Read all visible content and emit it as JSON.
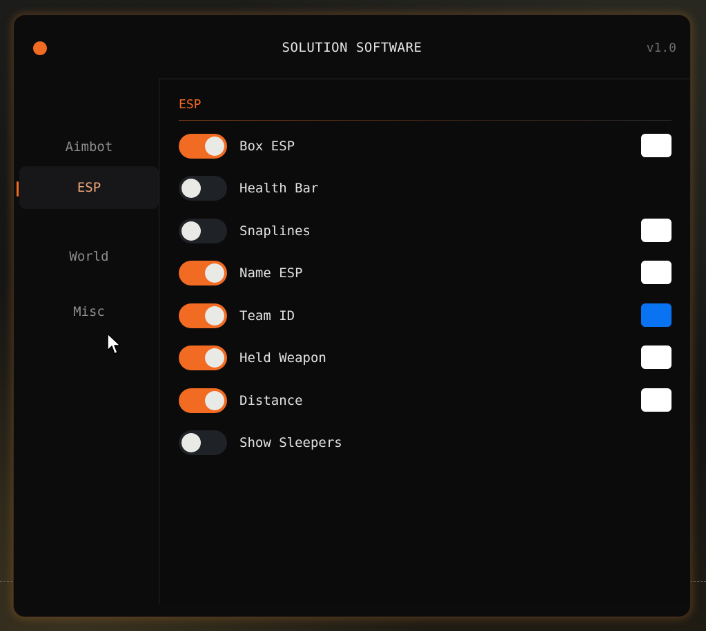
{
  "app": {
    "title": "SOLUTION SOFTWARE",
    "version": "v1.0",
    "accent_color": "#f26b22"
  },
  "sidebar": {
    "items": [
      {
        "label": "Aimbot",
        "active": false
      },
      {
        "label": "ESP",
        "active": true
      },
      {
        "label": "World",
        "active": false
      },
      {
        "label": "Misc",
        "active": false
      }
    ]
  },
  "section": {
    "title": "ESP",
    "rows": [
      {
        "label": "Box ESP",
        "enabled": true,
        "color": "#ffffff"
      },
      {
        "label": "Health Bar",
        "enabled": false,
        "color": null
      },
      {
        "label": "Snaplines",
        "enabled": false,
        "color": "#ffffff"
      },
      {
        "label": "Name ESP",
        "enabled": true,
        "color": "#ffffff"
      },
      {
        "label": "Team ID",
        "enabled": true,
        "color": "#0a73f2"
      },
      {
        "label": "Held Weapon",
        "enabled": true,
        "color": "#ffffff"
      },
      {
        "label": "Distance",
        "enabled": true,
        "color": "#ffffff"
      },
      {
        "label": "Show Sleepers",
        "enabled": false,
        "color": null
      }
    ]
  }
}
